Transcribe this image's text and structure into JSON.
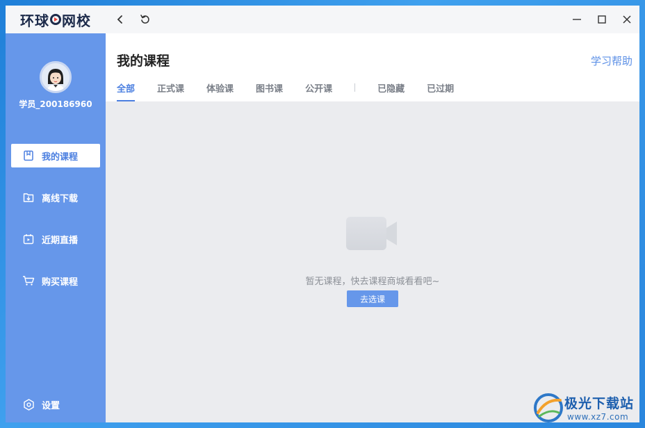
{
  "app": {
    "logo_text_a": "环球",
    "logo_text_b": "网校"
  },
  "sidebar": {
    "username": "学员_200186960",
    "items": [
      {
        "label": "我的课程",
        "icon": "course-book-icon"
      },
      {
        "label": "离线下载",
        "icon": "download-folder-icon"
      },
      {
        "label": "近期直播",
        "icon": "live-calendar-icon"
      },
      {
        "label": "购买课程",
        "icon": "shopping-cart-icon"
      }
    ],
    "settings_label": "设置"
  },
  "main": {
    "title": "我的课程",
    "help_link": "学习帮助",
    "tabs": [
      "全部",
      "正式课",
      "体验课",
      "图书课",
      "公开课"
    ],
    "tabs_secondary": [
      "已隐藏",
      "已过期"
    ],
    "active_tab": "全部"
  },
  "empty": {
    "message": "暂无课程，快去课程商城看看吧~",
    "button": "去选课"
  },
  "watermark": {
    "title": "极光下载站",
    "url": "www.xz7.com"
  },
  "colors": {
    "accent": "#6697ea",
    "active_text": "#4b7fe0",
    "content_bg": "#ebecef"
  }
}
